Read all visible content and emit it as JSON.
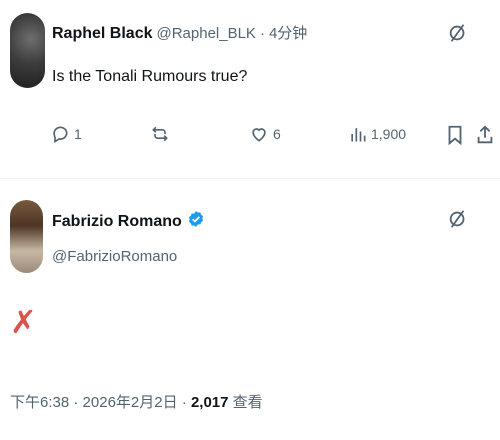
{
  "reply": {
    "name": "Raphel Black",
    "handle": "@Raphel_BLK",
    "separator": "·",
    "time": "4分钟",
    "text": "Is the Tonali Rumours true?",
    "actions": {
      "replies": "1",
      "reposts": "",
      "likes": "6",
      "views": "1,900"
    }
  },
  "tweet": {
    "name": "Fabrizio Romano",
    "handle": "@FabrizioRomano",
    "body": "✗",
    "time": "下午6:38",
    "date": "2026年2月2日",
    "separator": "·",
    "views": "2,017",
    "views_label": "查看"
  },
  "colors": {
    "accent": "#1d9bf0",
    "text": "#0f1419",
    "muted": "#536471",
    "x_mark": "#d9544d"
  },
  "icons": [
    "grok-icon",
    "reply-icon",
    "repost-icon",
    "like-icon",
    "views-icon",
    "bookmark-icon",
    "share-icon",
    "verified-badge-icon"
  ]
}
